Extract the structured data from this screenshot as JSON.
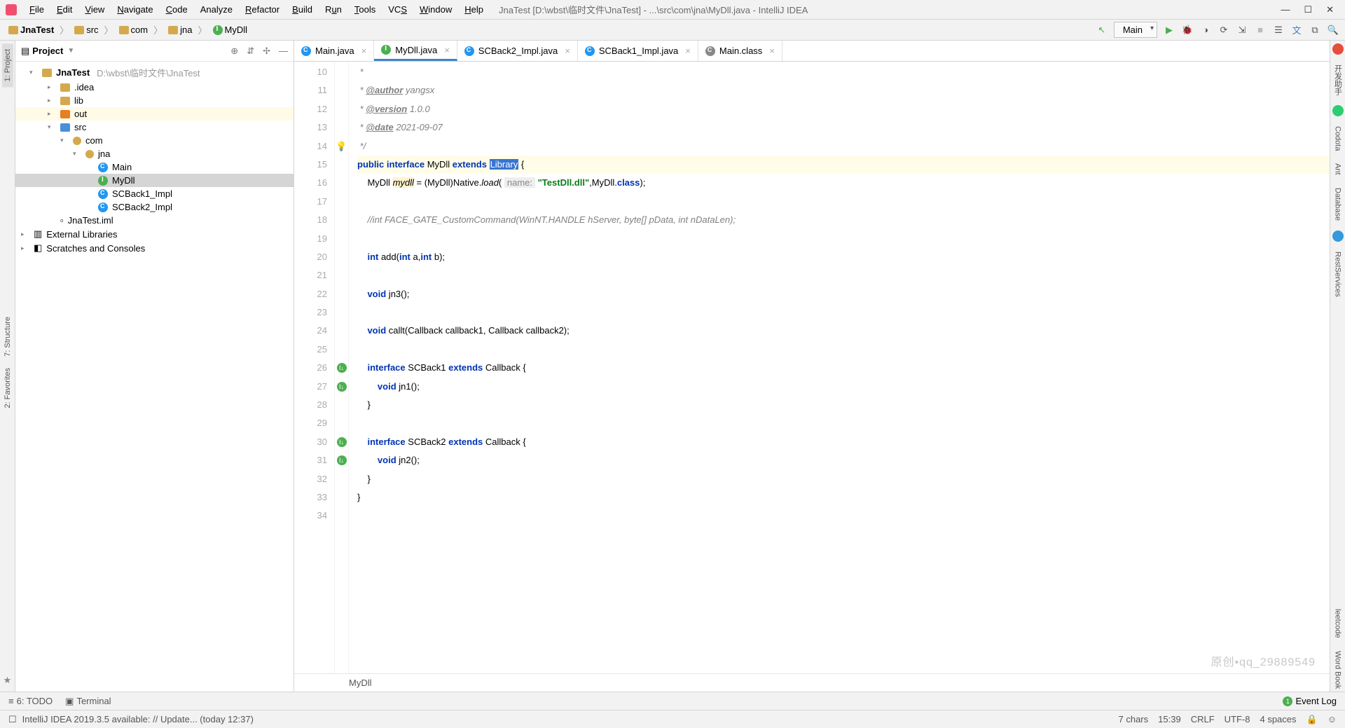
{
  "window": {
    "title": "JnaTest [D:\\wbst\\临时文件\\JnaTest] - ...\\src\\com\\jna\\MyDll.java - IntelliJ IDEA"
  },
  "menu": [
    "File",
    "Edit",
    "View",
    "Navigate",
    "Code",
    "Analyze",
    "Refactor",
    "Build",
    "Run",
    "Tools",
    "VCS",
    "Window",
    "Help"
  ],
  "breadcrumbs": [
    "JnaTest",
    "src",
    "com",
    "jna",
    "MyDll"
  ],
  "run_config": "Main",
  "project": {
    "label": "Project",
    "root_name": "JnaTest",
    "root_path": "D:\\wbst\\临时文件\\JnaTest",
    "idea": ".idea",
    "lib": "lib",
    "out": "out",
    "src": "src",
    "com": "com",
    "jna": "jna",
    "main": "Main",
    "mydll": "MyDll",
    "scback1": "SCBack1_Impl",
    "scback2": "SCBack2_Impl",
    "iml": "JnaTest.iml",
    "ext_lib": "External Libraries",
    "scratches": "Scratches and Consoles"
  },
  "tabs": [
    "Main.java",
    "MyDll.java",
    "SCBack2_Impl.java",
    "SCBack1_Impl.java",
    "Main.class"
  ],
  "code": {
    "author_tag": "@author",
    "author_val": " yangsx",
    "version_tag": "@version",
    "version_val": " 1.0.0",
    "date_tag": "@date",
    "date_val": " 2021-09-07",
    "library": "Library",
    "name_hint": "name:",
    "dll_str": "\"TestDll.dll\"",
    "cust_comment": "//int FACE_GATE_CustomCommand(WinNT.HANDLE hServer, byte[] pData, int nDataLen);",
    "scback1": "SCBack1",
    "scback2": "SCBack2",
    "crumb": "MyDll"
  },
  "left_tabs": {
    "project": "1: Project",
    "structure": "7: Structure",
    "favorites": "2: Favorites"
  },
  "right_tabs": {
    "assistant": "开发助手",
    "codota": "Codota",
    "ant": "Ant",
    "database": "Database",
    "rest": "RestServices",
    "leetcode": "leetcode",
    "wordbook": "Word Book"
  },
  "bottom_tabs": {
    "todo": "6: TODO",
    "terminal": "Terminal",
    "event_log": "Event Log"
  },
  "status": {
    "message": "IntelliJ IDEA 2019.3.5 available: // Update... (today 12:37)",
    "chars": "7 chars",
    "pos": "15:39",
    "le": "CRLF",
    "enc": "UTF-8",
    "indent": "4 spaces"
  },
  "watermark": "原创•qq_29889549"
}
